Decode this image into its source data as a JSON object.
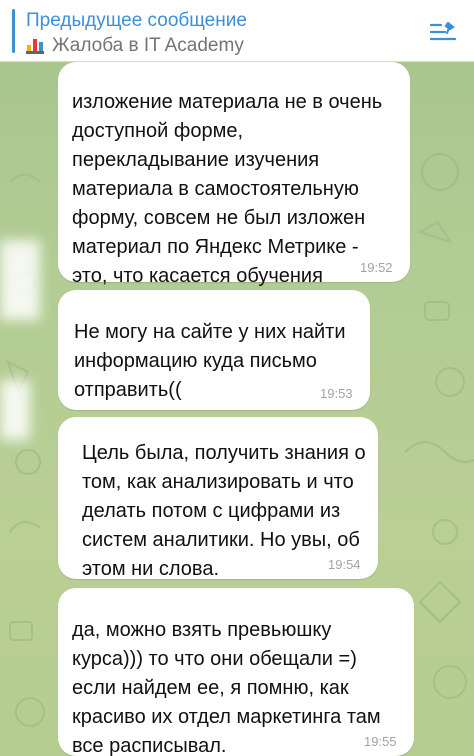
{
  "pinned": {
    "title": "Предыдущее сообщение",
    "subtitle": "Жалоба в IT Academy"
  },
  "messages": [
    {
      "text": "изложение материала не в очень\nдоступной форме,\nперекладывание изучения\nматериала в самостоятельную\nформу, совсем не был изложен\nматериал по Яндекс Метрике -\nэто, что касается обучения",
      "time": "19:52"
    },
    {
      "text": "Не могу на сайте у них найти\nинформацию куда письмо\nотправить((",
      "time": "19:53"
    },
    {
      "text": "Цель была, получить знания о\nтом, как анализировать и что\nделать потом с цифрами из\nсистем аналитики. Но увы, об\nэтом ни слова.",
      "time": "19:54"
    },
    {
      "text": "да, можно взять превьюшку\nкурса))) то что они обещали =)\nесли найдем ее, я помню, как\nкрасиво их отдел маркетинга там\nвсе расписывал.",
      "time": "19:55"
    }
  ],
  "icons": {
    "pinned_chart": "bar-chart-icon",
    "pinned_list": "pinned-list-icon"
  },
  "colors": {
    "accent": "#3d8fd6",
    "chat_background": "#b2cc93",
    "bubble": "#ffffff",
    "timestamp": "#a0a4a8"
  }
}
